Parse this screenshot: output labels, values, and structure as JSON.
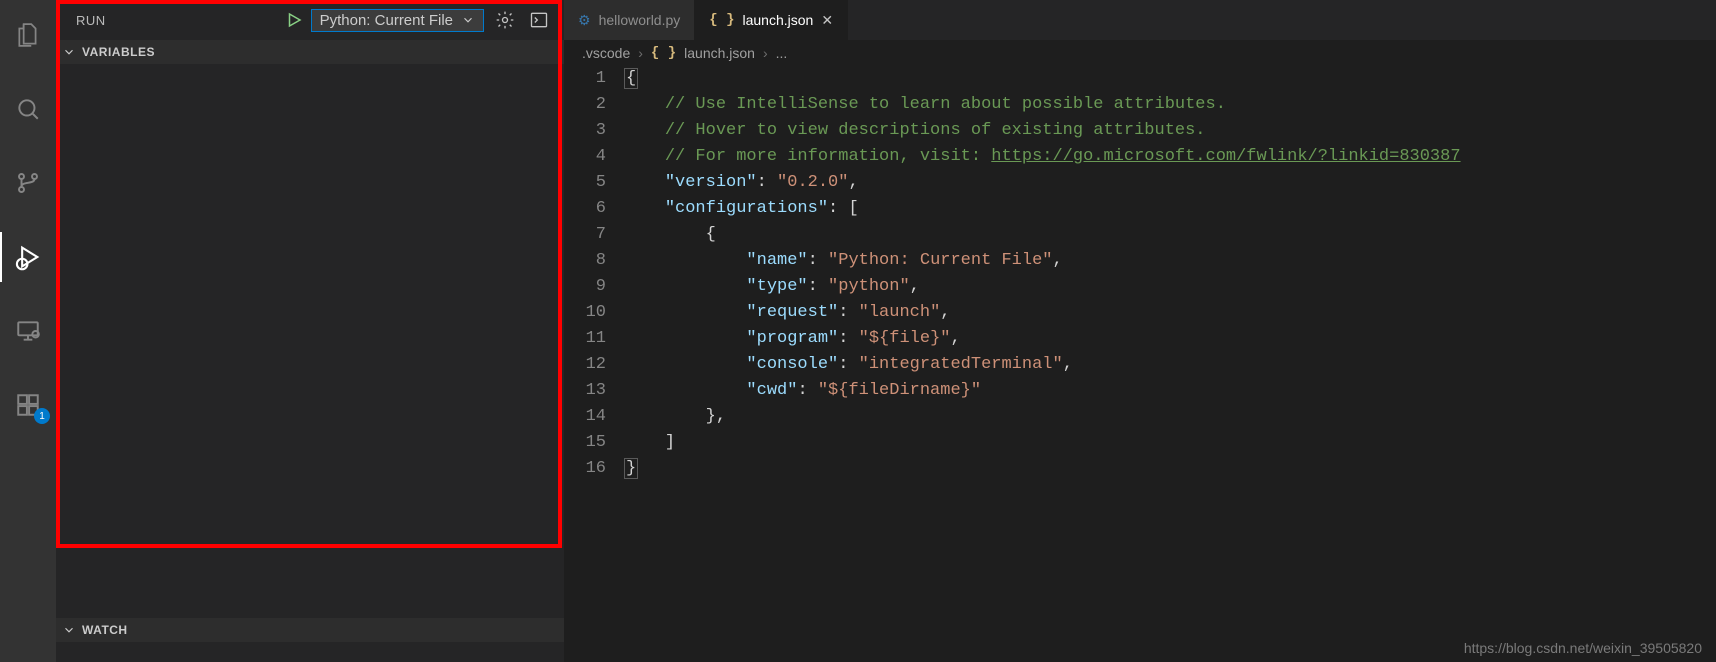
{
  "activity": {
    "items": [
      {
        "name": "explorer",
        "active": false
      },
      {
        "name": "search",
        "active": false
      },
      {
        "name": "scm",
        "active": false
      },
      {
        "name": "run-debug",
        "active": true
      },
      {
        "name": "remote",
        "active": false
      },
      {
        "name": "extensions",
        "active": false,
        "badge": "1"
      }
    ]
  },
  "run_panel": {
    "title": "RUN",
    "config_selected": "Python: Current File",
    "sections": {
      "variables": "VARIABLES",
      "watch": "WATCH"
    }
  },
  "tabs": [
    {
      "icon": "python",
      "label": "helloworld.py",
      "active": false
    },
    {
      "icon": "json",
      "label": "launch.json",
      "active": true,
      "closeable": true
    }
  ],
  "breadcrumbs": {
    "segments": [
      ".vscode",
      "launch.json",
      "..."
    ],
    "icon_on": 1,
    "icon_kind": "json"
  },
  "editor": {
    "line_count": 16,
    "tokens": [
      [
        {
          "c": "t-delim brace-hl",
          "t": "{"
        }
      ],
      [
        {
          "c": "",
          "t": "    "
        },
        {
          "c": "t-comment",
          "t": "// Use IntelliSense to learn about possible attributes."
        }
      ],
      [
        {
          "c": "",
          "t": "    "
        },
        {
          "c": "t-comment",
          "t": "// Hover to view descriptions of existing attributes."
        }
      ],
      [
        {
          "c": "",
          "t": "    "
        },
        {
          "c": "t-comment",
          "t": "// For more information, visit: "
        },
        {
          "c": "t-link",
          "t": "https://go.microsoft.com/fwlink/?linkid=830387"
        }
      ],
      [
        {
          "c": "",
          "t": "    "
        },
        {
          "c": "t-key",
          "t": "\"version\""
        },
        {
          "c": "t-punc",
          "t": ": "
        },
        {
          "c": "t-str",
          "t": "\"0.2.0\""
        },
        {
          "c": "t-punc",
          "t": ","
        }
      ],
      [
        {
          "c": "",
          "t": "    "
        },
        {
          "c": "t-key",
          "t": "\"configurations\""
        },
        {
          "c": "t-punc",
          "t": ": ["
        }
      ],
      [
        {
          "c": "",
          "t": "        "
        },
        {
          "c": "t-punc",
          "t": "{"
        }
      ],
      [
        {
          "c": "",
          "t": "            "
        },
        {
          "c": "t-key",
          "t": "\"name\""
        },
        {
          "c": "t-punc",
          "t": ": "
        },
        {
          "c": "t-str",
          "t": "\"Python: Current File\""
        },
        {
          "c": "t-punc",
          "t": ","
        }
      ],
      [
        {
          "c": "",
          "t": "            "
        },
        {
          "c": "t-key",
          "t": "\"type\""
        },
        {
          "c": "t-punc",
          "t": ": "
        },
        {
          "c": "t-str",
          "t": "\"python\""
        },
        {
          "c": "t-punc",
          "t": ","
        }
      ],
      [
        {
          "c": "",
          "t": "            "
        },
        {
          "c": "t-key",
          "t": "\"request\""
        },
        {
          "c": "t-punc",
          "t": ": "
        },
        {
          "c": "t-str",
          "t": "\"launch\""
        },
        {
          "c": "t-punc",
          "t": ","
        }
      ],
      [
        {
          "c": "",
          "t": "            "
        },
        {
          "c": "t-key",
          "t": "\"program\""
        },
        {
          "c": "t-punc",
          "t": ": "
        },
        {
          "c": "t-str",
          "t": "\"${file}\""
        },
        {
          "c": "t-punc",
          "t": ","
        }
      ],
      [
        {
          "c": "",
          "t": "            "
        },
        {
          "c": "t-key",
          "t": "\"console\""
        },
        {
          "c": "t-punc",
          "t": ": "
        },
        {
          "c": "t-str",
          "t": "\"integratedTerminal\""
        },
        {
          "c": "t-punc",
          "t": ","
        }
      ],
      [
        {
          "c": "",
          "t": "            "
        },
        {
          "c": "t-key",
          "t": "\"cwd\""
        },
        {
          "c": "t-punc",
          "t": ": "
        },
        {
          "c": "t-str",
          "t": "\"${fileDirname}\""
        }
      ],
      [
        {
          "c": "",
          "t": "        "
        },
        {
          "c": "t-punc",
          "t": "},"
        }
      ],
      [
        {
          "c": "",
          "t": "    "
        },
        {
          "c": "t-punc",
          "t": "]"
        }
      ],
      [
        {
          "c": "t-delim brace-hl",
          "t": "}"
        }
      ]
    ]
  },
  "watermark": "https://blog.csdn.net/weixin_39505820"
}
